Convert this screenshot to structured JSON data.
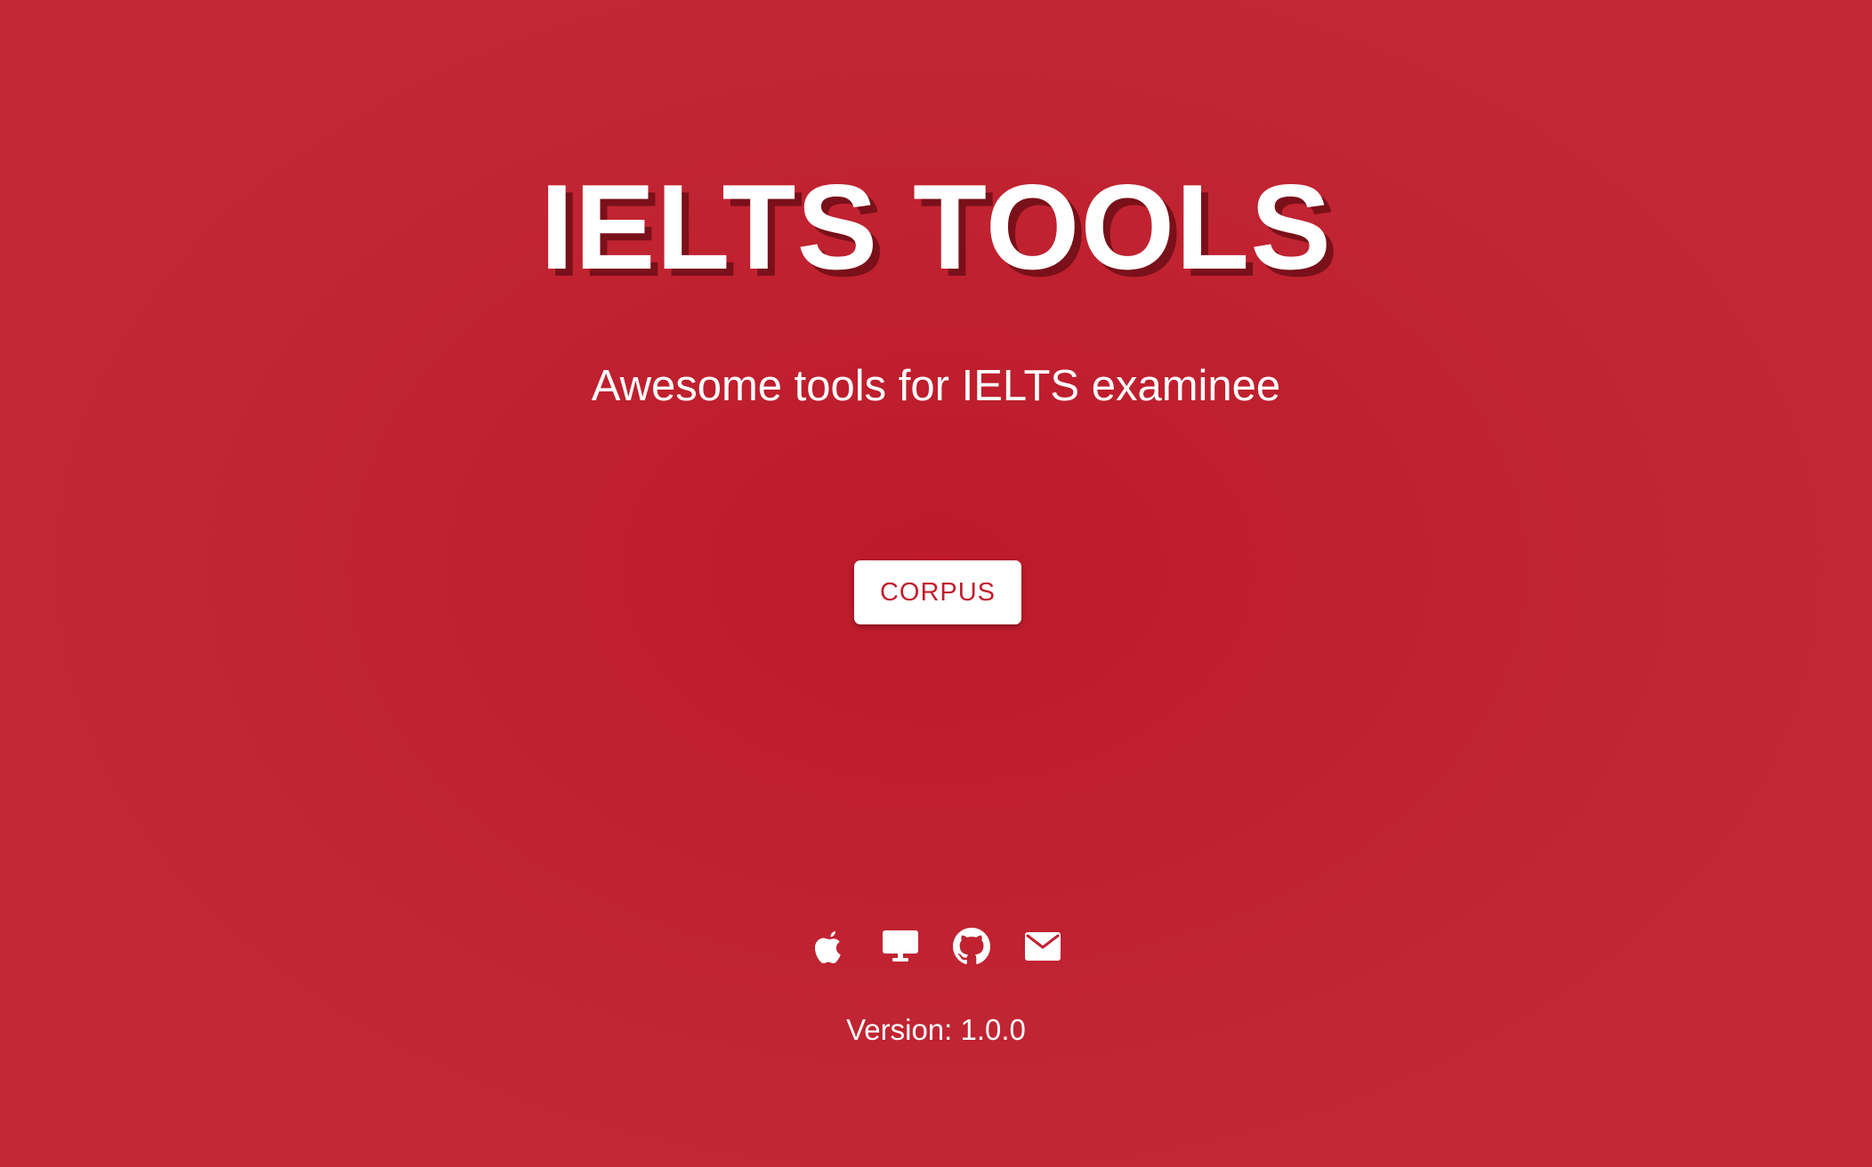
{
  "header": {
    "title": "IELTS TOOLS",
    "subtitle": "Awesome tools for IELTS examinee"
  },
  "main": {
    "corpus_button_label": "CORPUS"
  },
  "footer": {
    "links": [
      {
        "icon": "apple-icon"
      },
      {
        "icon": "desktop-icon"
      },
      {
        "icon": "github-icon"
      },
      {
        "icon": "mail-icon"
      }
    ],
    "version_text": "Version: 1.0.0"
  },
  "colors": {
    "background": "#c02230",
    "title_shadow": "#7a1019",
    "button_text": "#c01e2e",
    "foreground": "#ffffff"
  }
}
